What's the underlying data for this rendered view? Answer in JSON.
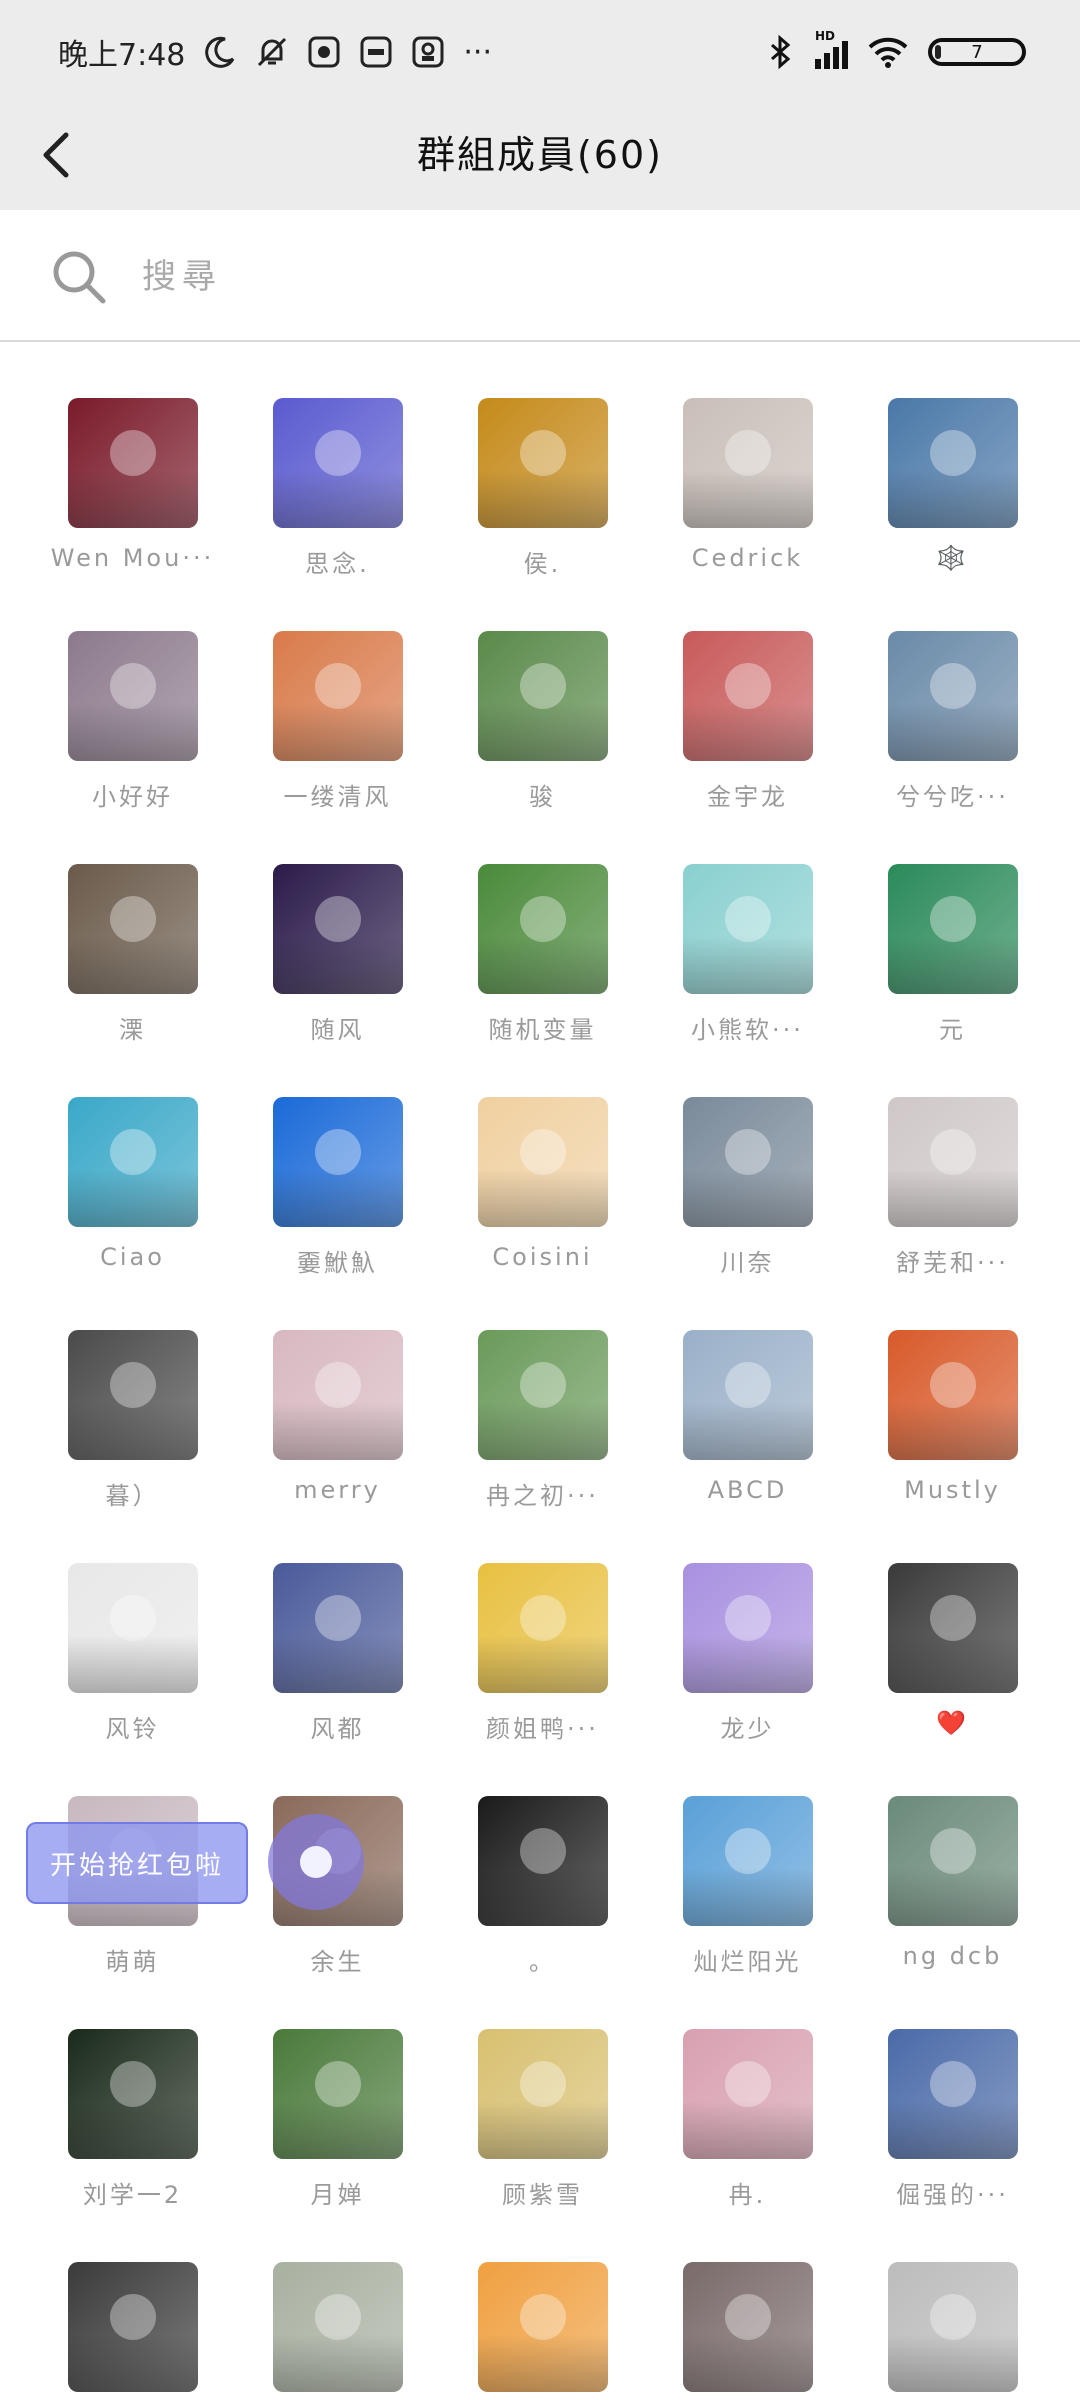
{
  "status_bar": {
    "time": "晚上7:48",
    "more": "···",
    "battery": {
      "level_text": "7",
      "level_fraction": 0.07
    },
    "signal_badge": "HD",
    "left_icons": [
      "moon-icon",
      "bell-off-icon",
      "app-icon",
      "app-icon",
      "app-icon"
    ],
    "right_icons": [
      "bluetooth-icon",
      "signal-icon",
      "wifi-icon",
      "battery-icon"
    ]
  },
  "header": {
    "title": "群組成員(60)",
    "back_icon": "chevron-left-icon"
  },
  "search": {
    "placeholder": "搜尋",
    "value": ""
  },
  "members": [
    {
      "name": "Wen Mou···",
      "color": "#7a1a2a"
    },
    {
      "name": "思念.",
      "color": "#5a5ad0"
    },
    {
      "name": "侯.",
      "color": "#c58a1a"
    },
    {
      "name": "Cedrick",
      "color": "#c9bfb8"
    },
    {
      "name": "🕸️",
      "color": "#4a78a8"
    },
    {
      "name": "小好好",
      "color": "#8c7a8c"
    },
    {
      "name": "一缕清风",
      "color": "#d97a4a"
    },
    {
      "name": "骏",
      "color": "#5a8a4a"
    },
    {
      "name": "金宇龙",
      "color": "#c85a5a"
    },
    {
      "name": "兮兮吃···",
      "color": "#6a8aa8"
    },
    {
      "name": "溧",
      "color": "#6a5a4a"
    },
    {
      "name": "随风",
      "color": "#2a1a4a"
    },
    {
      "name": "随机变量",
      "color": "#4a8a3a"
    },
    {
      "name": "小熊软···",
      "color": "#8ad0d0"
    },
    {
      "name": "元",
      "color": "#2a8a5a"
    },
    {
      "name": "Ciao",
      "color": "#3aa8c8"
    },
    {
      "name": "嫑鮲魞",
      "color": "#1a6ad8"
    },
    {
      "name": "Coisini",
      "color": "#f0d0a0"
    },
    {
      "name": "川奈",
      "color": "#7a8a9a"
    },
    {
      "name": "舒芜和···",
      "color": "#d0c8c8"
    },
    {
      "name": "暮）",
      "color": "#4a4a4a"
    },
    {
      "name": "merry",
      "color": "#d8b8c0"
    },
    {
      "name": "冉之初···",
      "color": "#6a9a5a"
    },
    {
      "name": "ABCD",
      "color": "#9ab0c8"
    },
    {
      "name": "Mustly",
      "color": "#d85a2a"
    },
    {
      "name": "风铃",
      "color": "#e8e8e8"
    },
    {
      "name": "风都",
      "color": "#4a5a9a"
    },
    {
      "name": "颜姐鸭···",
      "color": "#e8c040"
    },
    {
      "name": "龙少",
      "color": "#a890e0"
    },
    {
      "name": "❤️",
      "color": "#3a3a3a"
    },
    {
      "name": "萌萌",
      "color": "#c8b8c0"
    },
    {
      "name": "余生",
      "color": "#8a6a5a"
    },
    {
      "name": "。",
      "color": "#1a1a1a"
    },
    {
      "name": "灿烂阳光",
      "color": "#5aa0d8"
    },
    {
      "name": "ng dcb",
      "color": "#6a8a7a"
    },
    {
      "name": "刘学一2",
      "color": "#1a2a1a"
    },
    {
      "name": "月婵",
      "color": "#4a7a3a"
    },
    {
      "name": "顾紫雪",
      "color": "#d8c070"
    },
    {
      "name": "冉.",
      "color": "#d8a0b0"
    },
    {
      "name": "倔强的···",
      "color": "#4a6aa8"
    },
    {
      "name": "",
      "color": "#3a3a3a"
    },
    {
      "name": "",
      "color": "#a8b0a0"
    },
    {
      "name": "",
      "color": "#f0a040"
    },
    {
      "name": "",
      "color": "#7a6a6a"
    },
    {
      "name": "",
      "color": "#bcbcbc"
    }
  ],
  "overlay": {
    "red_packet_label": "开始抢红包啦",
    "disc_icon": "music-disc-icon"
  }
}
